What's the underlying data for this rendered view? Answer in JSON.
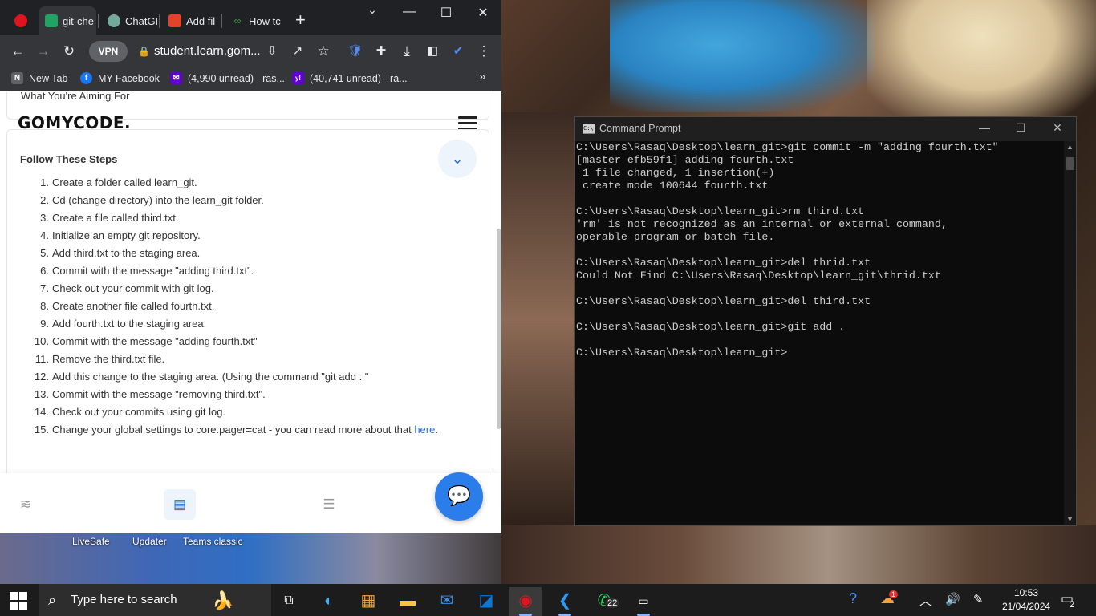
{
  "browser": {
    "tabs": [
      {
        "label": "",
        "favicon": "opera-icon",
        "color": "#e0141e"
      },
      {
        "label": "git-che",
        "favicon": "google-drive-icon",
        "color": "#1fa463"
      },
      {
        "label": "ChatGF",
        "favicon": "chatgpt-icon",
        "color": "#74aa9c"
      },
      {
        "label": "Add fil",
        "favicon": "gitlab-icon",
        "color": "#e24329"
      },
      {
        "label": "How tc",
        "favicon": "link-icon",
        "color": "#3fa34d"
      }
    ],
    "new_tab_symbol": "+",
    "vpn_label": "VPN",
    "url": "student.learn.gom...",
    "bookmarks": [
      {
        "label": "New Tab",
        "icon": "N",
        "color": "#5f6368"
      },
      {
        "label": "MY Facebook",
        "icon": "f",
        "color": "#1877f2"
      },
      {
        "label": "(4,990 unread) - ras...",
        "icon": "✉",
        "color": "#6001d2"
      },
      {
        "label": "(40,741 unread) - ra...",
        "icon": "y!",
        "color": "#6001d2"
      }
    ],
    "bookmarks_more": "»"
  },
  "page": {
    "prev_section_title": "What You're Aiming For",
    "logo": "GOMYCODE.",
    "section_title": "Follow These Steps",
    "steps": [
      {
        "n": "1.",
        "text": "Create a folder called learn_git."
      },
      {
        "n": "2.",
        "text": "Cd (change directory) into the learn_git folder."
      },
      {
        "n": "3.",
        "text": "Create a file called third.txt."
      },
      {
        "n": "4.",
        "text": "Initialize an empty git repository."
      },
      {
        "n": "5.",
        "text": "Add third.txt to the staging area."
      },
      {
        "n": "6.",
        "text": "Commit with the message \"adding third.txt\"."
      },
      {
        "n": "7.",
        "text": "Check out your commit with git log."
      },
      {
        "n": "8.",
        "text": "Create another file called fourth.txt."
      },
      {
        "n": "9.",
        "text": "Add fourth.txt to the staging area."
      },
      {
        "n": "10.",
        "text": "Commit with the message \"adding fourth.txt\""
      },
      {
        "n": "11.",
        "text": "Remove the third.txt file."
      },
      {
        "n": "12.",
        "text": "Add this change to the staging area. (Using the command \"git add . \""
      },
      {
        "n": "13.",
        "text": "Commit with the message \"removing third.txt\"."
      },
      {
        "n": "14.",
        "text": "Check out your commits using git log."
      },
      {
        "n": "15.",
        "text": "Change your global settings to core.pager=cat - you can read more about that ",
        "link": "here",
        "after": "."
      }
    ]
  },
  "desktop_labels": [
    "LiveSafe",
    "Updater",
    "Teams classic"
  ],
  "cmd": {
    "title": "Command Prompt",
    "icon_text": "C:\\",
    "lines": [
      "C:\\Users\\Rasaq\\Desktop\\learn_git>git commit -m \"adding fourth.txt\"",
      "[master efb59f1] adding fourth.txt",
      " 1 file changed, 1 insertion(+)",
      " create mode 100644 fourth.txt",
      "",
      "C:\\Users\\Rasaq\\Desktop\\learn_git>rm third.txt",
      "'rm' is not recognized as an internal or external command,",
      "operable program or batch file.",
      "",
      "C:\\Users\\Rasaq\\Desktop\\learn_git>del thrid.txt",
      "Could Not Find C:\\Users\\Rasaq\\Desktop\\learn_git\\thrid.txt",
      "",
      "C:\\Users\\Rasaq\\Desktop\\learn_git>del third.txt",
      "",
      "C:\\Users\\Rasaq\\Desktop\\learn_git>git add .",
      "",
      "C:\\Users\\Rasaq\\Desktop\\learn_git>"
    ]
  },
  "taskbar": {
    "search_placeholder": "Type here to search",
    "whatsapp_badge": "22",
    "weather_badge": "1",
    "time": "10:53",
    "date": "21/04/2024",
    "notification_count": "2"
  }
}
